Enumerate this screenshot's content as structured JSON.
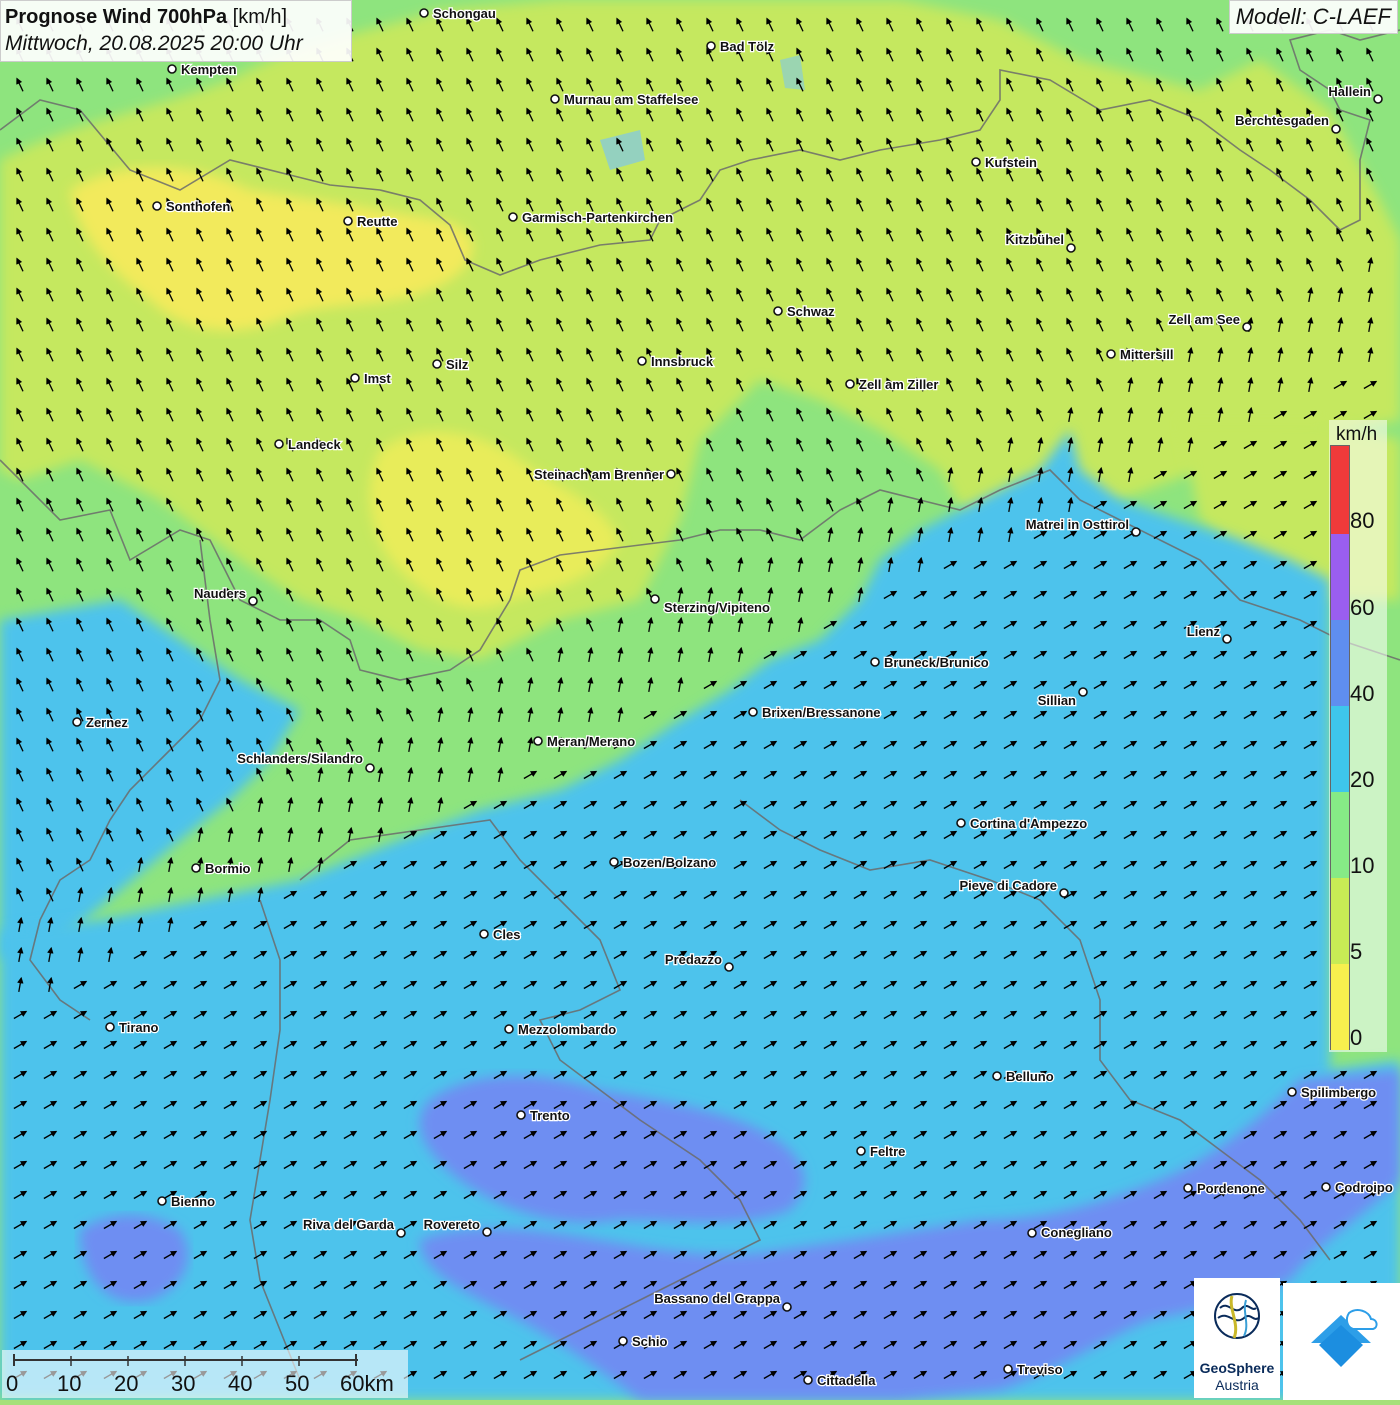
{
  "map_data": {
    "title": "Prognose Wind 700hPa",
    "unit": "[km/h]",
    "subtitle": "Mittwoch, 20.08.2025 20:00 Uhr",
    "model": "Modell: C-LAEF",
    "legend": {
      "unit": "km/h",
      "ticks": [
        "0",
        "5",
        "10",
        "20",
        "40",
        "60",
        "80"
      ],
      "colors": [
        "#f7f04e",
        "#c8ec55",
        "#86ea86",
        "#3ec6ec",
        "#5f8ef0",
        "#9a5ef0",
        "#f03a3a"
      ]
    },
    "field_colors": {
      "0-5": "#f2ea5c",
      "5-10": "#c5e85e",
      "10-20": "#8ee47e",
      "20-40": "#4ec3ec",
      "40-60": "#6e8ef2"
    },
    "wind_direction": {
      "north": "from south-east (arrows pointing north-west)",
      "south": "from south-west (arrows pointing north-east)"
    },
    "cities": [
      {
        "name": "Schongau"
      },
      {
        "name": "Bad Tölz"
      },
      {
        "name": "Kempten"
      },
      {
        "name": "Murnau am Staffelsee"
      },
      {
        "name": "Hallein"
      },
      {
        "name": "Berchtesgaden"
      },
      {
        "name": "Kufstein"
      },
      {
        "name": "Sonthofen"
      },
      {
        "name": "Reutte"
      },
      {
        "name": "Garmisch-Partenkirchen"
      },
      {
        "name": "Kitzbühel"
      },
      {
        "name": "Schwaz"
      },
      {
        "name": "Zell am See"
      },
      {
        "name": "Mittersill"
      },
      {
        "name": "Innsbruck"
      },
      {
        "name": "Silz"
      },
      {
        "name": "Imst"
      },
      {
        "name": "Zell am Ziller"
      },
      {
        "name": "Landeck"
      },
      {
        "name": "Steinach am Brenner"
      },
      {
        "name": "Matrei in Osttirol"
      },
      {
        "name": "Nauders"
      },
      {
        "name": "Sterzing/Vipiteno"
      },
      {
        "name": "Lienz"
      },
      {
        "name": "Bruneck/Brunico"
      },
      {
        "name": "Sillian"
      },
      {
        "name": "Zernez"
      },
      {
        "name": "Brixen/Bressanone"
      },
      {
        "name": "Meran/Merano"
      },
      {
        "name": "Schlanders/Silandro"
      },
      {
        "name": "Cortina d'Ampezzo"
      },
      {
        "name": "Bozen/Bolzano"
      },
      {
        "name": "Bormio"
      },
      {
        "name": "Pieve di Cadore"
      },
      {
        "name": "Cles"
      },
      {
        "name": "Predazzo"
      },
      {
        "name": "Tirano"
      },
      {
        "name": "Mezzolombardo"
      },
      {
        "name": "Belluno"
      },
      {
        "name": "Spilimbergo"
      },
      {
        "name": "Trento"
      },
      {
        "name": "Feltre"
      },
      {
        "name": "Pordenone"
      },
      {
        "name": "Codroipo"
      },
      {
        "name": "Bienno"
      },
      {
        "name": "Riva del Garda"
      },
      {
        "name": "Rovereto"
      },
      {
        "name": "Conegliano"
      },
      {
        "name": "Bassano del Grappa"
      },
      {
        "name": "Schio"
      },
      {
        "name": "Treviso"
      },
      {
        "name": "Cittadella"
      }
    ],
    "scalebar": {
      "labels": [
        "0",
        "10",
        "20",
        "30",
        "40",
        "50",
        "60km"
      ]
    },
    "logo": {
      "line1": "GeoSphere",
      "line2": "Austria"
    }
  }
}
